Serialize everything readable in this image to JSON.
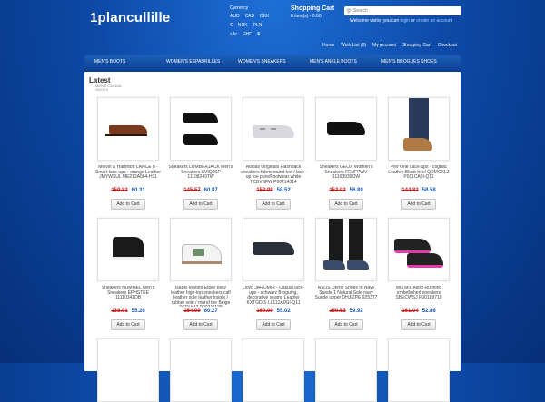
{
  "header": {
    "logo": "1plancullille",
    "currency_title": "Currency",
    "currencies_row1": [
      "AUD",
      "CAD",
      "DKK"
    ],
    "currencies_row2": [
      "€",
      "NOK",
      "PLN"
    ],
    "currencies_row3": [
      "s.kr",
      "CHF",
      "$"
    ],
    "cart_title": "Shopping Cart",
    "cart_summary": "0 item(s) - 0.00",
    "search_placeholder": "Search",
    "welcome_prefix": "Welcome visitor you can",
    "login_link": "login",
    "or_text": "or",
    "register_link": "create an account",
    "nav": [
      "Home",
      "Wish List (0)",
      "My Account",
      "Shopping Cart",
      "Checkout"
    ]
  },
  "categories": [
    "MEN'S BOOTS",
    "WOMEN'S ESPADRILLES",
    "WOMEN'S SNEAKERS",
    "MEN'S ANKLE BOOTS",
    "MEN'S BROGUES SHOES"
  ],
  "content": {
    "heading": "Latest",
    "breadcrumb": "MEN'S CASUAL SHOES",
    "add_label": "Add to Cart",
    "products": [
      {
        "name": "Melvin & Hamilton LANCE 8 - Smart lace-ups - orange Leather JMYWSUL ME212A064-H11",
        "old": "159.83",
        "new": "60.31"
      },
      {
        "name": "Sneakers LUMBERJACK Men's Sneakers SVIQJSP 11108249TW",
        "old": "145.57",
        "new": "60.87"
      },
      {
        "name": "Adidas Originals Flashback sneakers fabric round toe / lace-up toe pure/Footwear white TCBVSFW P00214314",
        "old": "153.98",
        "new": "58.52"
      },
      {
        "name": "Sneakers GEOX Women's Sneakers FENFPWV 11163939OW",
        "old": "152.92",
        "new": "56.89"
      },
      {
        "name": "Pier One Lace-ups - cognac Leather Black heel QDMCXLZ P911CA0I-Q11",
        "old": "144.83",
        "new": "58.58"
      },
      {
        "name": "Sneakers HUMMEL Men's Sneakers EPHSTKE 11110341DB",
        "old": "138.91",
        "new": "55.26"
      },
      {
        "name": "Isabel Marant Étoile Bilsy leather high-top sneakers calf leather sole leather insole / rubber sole / round toe Beige PSDVAIZ P00211128",
        "old": "154.99",
        "new": "60.27"
      },
      {
        "name": "Lloyd JAROMIR - Casual lace-ups - schwarz Broguing, decorative seams Leather KXTGDIS LL112A0GI-Q11",
        "old": "169.09",
        "new": "55.02"
      },
      {
        "name": "ASOS Derby Shoes In Navy Suede 1 Natural Sole navy Suede upper DHJIZPE 925377",
        "old": "159.52",
        "new": "59.92"
      },
      {
        "name": "Miu Miu Astro Running embellished sneakers SBECWSJ P00189719",
        "old": "161.04",
        "new": "52.86"
      }
    ]
  }
}
